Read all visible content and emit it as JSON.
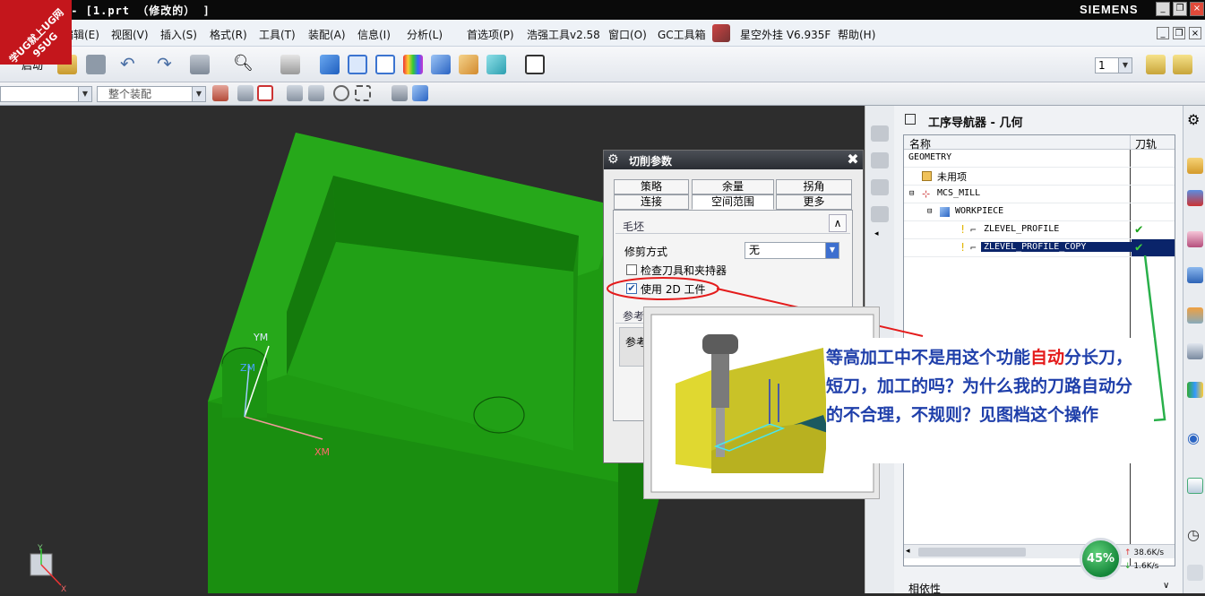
{
  "window": {
    "title": "工 - [1.prt （修改的） ]",
    "brand": "SIEMENS",
    "logo_text": "学UG就上UG网 9SUG"
  },
  "menu": [
    "编辑(E)",
    "视图(V)",
    "插入(S)",
    "格式(R)",
    "工具(T)",
    "装配(A)",
    "信息(I)",
    "分析(L)",
    "首选项(P)",
    "浩强工具v2.58",
    "窗口(O)",
    "GC工具箱",
    "星空外挂 V6.935F",
    "帮助(H)"
  ],
  "toolbar": {
    "start_label": "启动",
    "layer_value": "1",
    "assembly_filter": "整个装配"
  },
  "viewport": {
    "axis_ym": "YM",
    "axis_zm": "ZM",
    "axis_xm": "XM",
    "triad_y": "Y",
    "triad_x": "X"
  },
  "dialog": {
    "title": "切削参数",
    "tabs_row1": [
      "策略",
      "余量",
      "拐角"
    ],
    "tabs_row2": [
      "连接",
      "空间范围",
      "更多"
    ],
    "active_tab": "空间范围",
    "section_blank": "毛坯",
    "trim_label": "修剪方式",
    "trim_value": "无",
    "check_tool_holder": "检查刀具和夹持器",
    "use_2d_ipw": "使用 2D 工件",
    "section_ref_partial": "参考",
    "ref_field_partial": "参考"
  },
  "navigator": {
    "title": "工序导航器 - 几何",
    "col_name": "名称",
    "col_path": "刀轨",
    "rows": [
      {
        "label": "GEOMETRY",
        "indent": 0,
        "check": false,
        "selected": false
      },
      {
        "label": "未用项",
        "indent": 1,
        "check": false,
        "selected": false
      },
      {
        "label": "MCS_MILL",
        "indent": 1,
        "check": false,
        "selected": false
      },
      {
        "label": "WORKPIECE",
        "indent": 2,
        "check": false,
        "selected": false
      },
      {
        "label": "ZLEVEL_PROFILE",
        "indent": 3,
        "check": true,
        "selected": false
      },
      {
        "label": "ZLEVEL_PROFILE_COPY",
        "indent": 3,
        "check": true,
        "selected": true
      }
    ],
    "bottom_section": "相依性"
  },
  "annotation": {
    "line1_pre": "等高加工中不是用这个功能",
    "line1_hl": "自动",
    "line1_post": "分长刀，",
    "line2": "短刀，加工的吗？为什么我的刀路自动分",
    "line3": "的不合理，不规则？见图档这个操作"
  },
  "network": {
    "percent": "45%",
    "up": "38.6K/s",
    "down": "1.6K/s"
  },
  "colors": {
    "part_green": "#1e9a12",
    "highlight_red": "#e41b1b",
    "callout_green": "#29b04a",
    "nav_selected": "#0a246a"
  }
}
